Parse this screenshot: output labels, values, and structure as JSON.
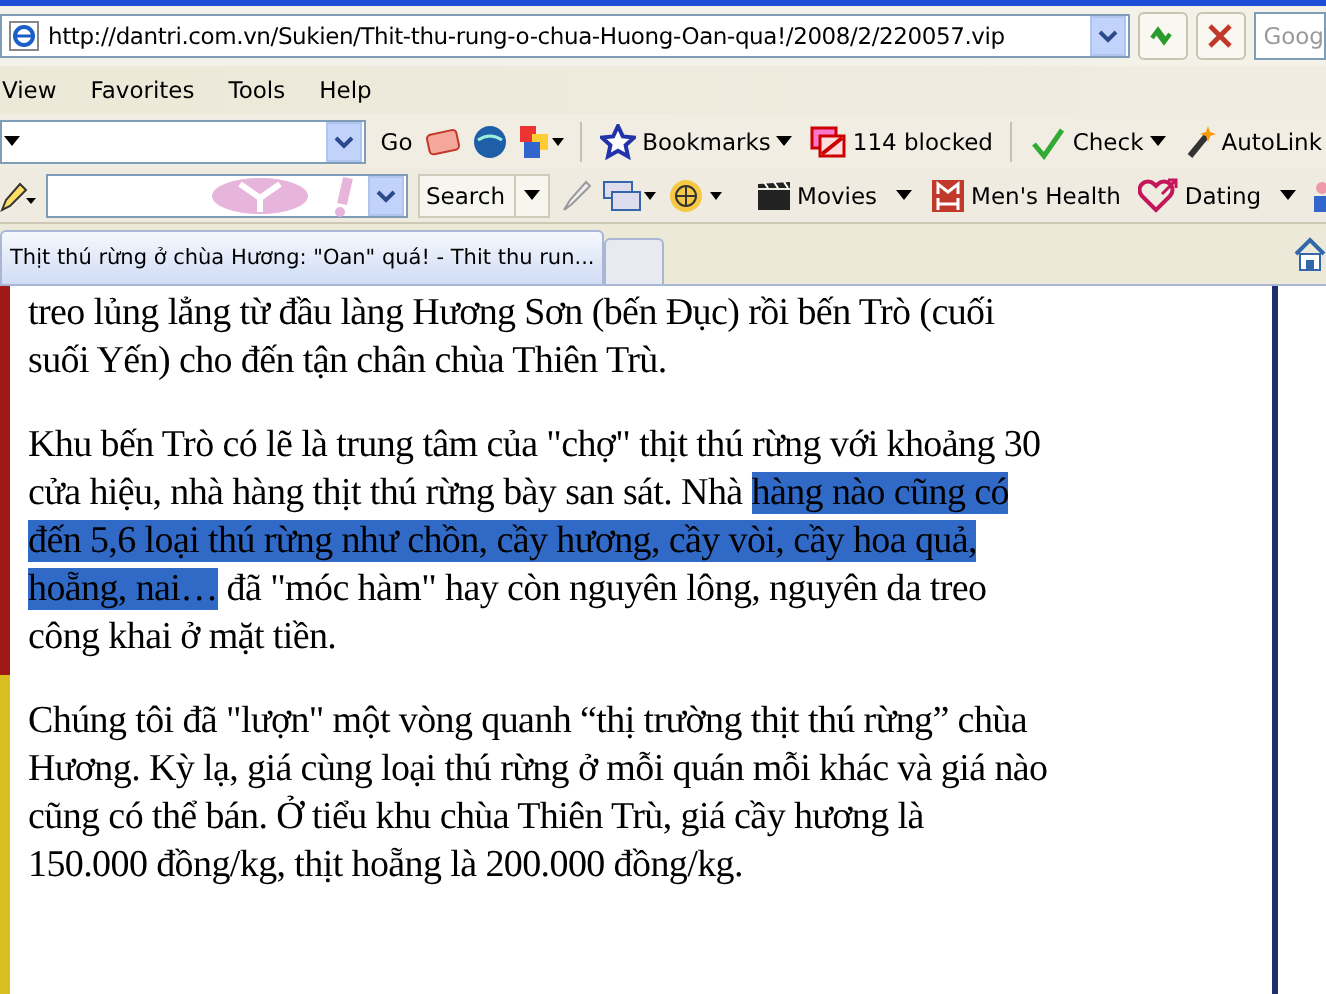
{
  "address_bar": {
    "url": "http://dantri.com.vn/Sukien/Thit-thu-rung-o-chua-Huong-Oan-qua!/2008/2/220057.vip",
    "search_placeholder": "Goog"
  },
  "menu": [
    "View",
    "Favorites",
    "Tools",
    "Help"
  ],
  "toolbar_1": {
    "go": "Go",
    "bookmarks": "Bookmarks",
    "blocked": "114 blocked",
    "check": "Check",
    "autolink": "AutoLink"
  },
  "toolbar_2": {
    "search": "Search",
    "links": [
      {
        "label": "Movies",
        "kind": "movies",
        "dropdown": true
      },
      {
        "label": "Men's Health",
        "kind": "health",
        "dropdown": false
      },
      {
        "label": "Dating",
        "kind": "dating",
        "dropdown": true
      }
    ]
  },
  "tabs": [
    {
      "label": "Thịt thú rừng ở chùa Hương: \"Oan\" quá! - Thit thu run...",
      "selected": true
    },
    {
      "selected": false
    }
  ],
  "article": {
    "paragraphs": [
      {
        "lines": [
          [
            {
              "text": "treo lủng lẳng từ đầu làng Hương Sơn (bến Đục) rồi bến Trò (cuối",
              "selected": false
            }
          ],
          [
            {
              "text": "suối Yến) cho đến tận chân chùa Thiên Trù.",
              "selected": false
            }
          ]
        ]
      },
      {
        "lines": [
          [
            {
              "text": "Khu bến Trò có lẽ là trung tâm của \"chợ\" thịt thú rừng với khoảng 30",
              "selected": false
            }
          ],
          [
            {
              "text": "cửa hiệu, nhà hàng thịt thú rừng bày san sát. Nhà ",
              "selected": false
            },
            {
              "text": "hàng nào cũng có",
              "selected": true
            }
          ],
          [
            {
              "text": "đến 5,6 loại thú rừng như chồn, cầy hương, cầy vòi, cầy hoa quả,",
              "selected": true
            }
          ],
          [
            {
              "text": "hoẵng, nai…",
              "selected": true
            },
            {
              "text": " đã \"móc hàm\" hay còn nguyên lông, nguyên da treo",
              "selected": false
            }
          ],
          [
            {
              "text": "công khai ở mặt tiền.",
              "selected": false
            }
          ]
        ]
      },
      {
        "lines": [
          [
            {
              "text": "Chúng tôi đã \"lượn\" một vòng quanh “thị trường thịt thú rừng” chùa",
              "selected": false
            }
          ],
          [
            {
              "text": "Hương. Kỳ lạ, giá cùng loại thú rừng ở mỗi quán mỗi khác và giá nào",
              "selected": false
            }
          ],
          [
            {
              "text": "cũng có thể bán. Ở tiểu khu chùa Thiên Trù, giá cầy hương là",
              "selected": false
            }
          ],
          [
            {
              "text": "150.000 đồng/kg, thịt hoẵng là 200.000 đồng/kg.",
              "selected": false
            }
          ]
        ]
      }
    ]
  }
}
